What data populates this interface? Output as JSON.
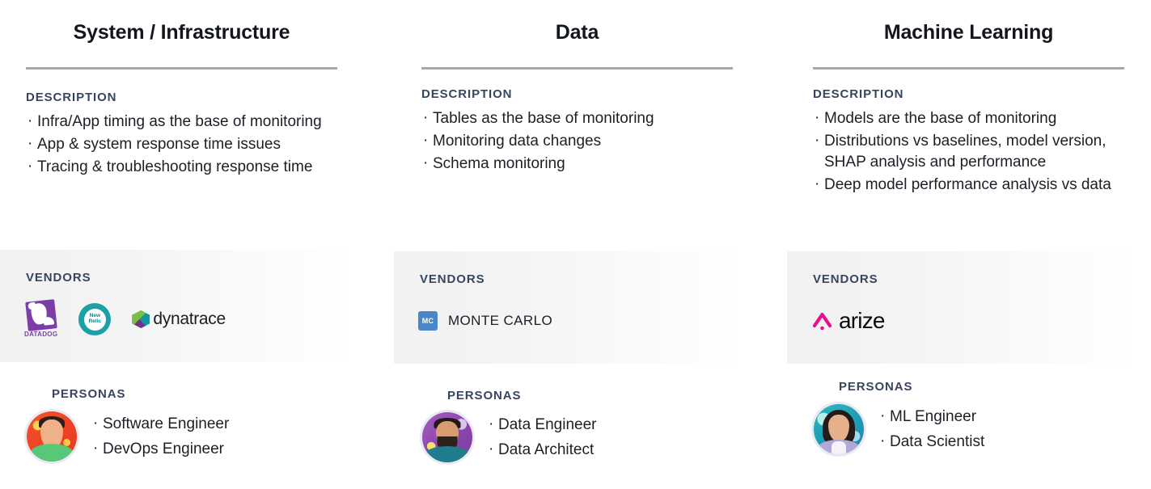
{
  "columns": [
    {
      "title": "System / Infrastructure",
      "description_label": "DESCRIPTION",
      "description_items": [
        "Infra/App timing as the base of monitoring",
        "App & system response time issues",
        "Tracing & troubleshooting response time"
      ],
      "vendors_label": "VENDORS",
      "vendors": [
        {
          "name": "DATADOG",
          "icon": "datadog-logo"
        },
        {
          "name": "New Relic",
          "icon": "new-relic-logo",
          "line1": "New",
          "line2": "Relic"
        },
        {
          "name": "dynatrace",
          "icon": "dynatrace-logo"
        }
      ],
      "personas_label": "PERSONAS",
      "persona_avatar": "persona-avatar-software-engineer",
      "personas": [
        "Software Engineer",
        "DevOps Engineer"
      ]
    },
    {
      "title": "Data",
      "description_label": "DESCRIPTION",
      "description_items": [
        "Tables as the base of monitoring",
        "Monitoring data changes",
        "Schema monitoring"
      ],
      "vendors_label": "VENDORS",
      "vendors": [
        {
          "name": "MONTE CARLO",
          "icon": "monte-carlo-logo",
          "monogram": "MC"
        }
      ],
      "personas_label": "PERSONAS",
      "persona_avatar": "persona-avatar-data-engineer",
      "personas": [
        "Data Engineer",
        "Data Architect"
      ]
    },
    {
      "title": "Machine Learning",
      "description_label": "DESCRIPTION",
      "description_items": [
        "Models are the base of monitoring",
        "Distributions vs baselines, model version, SHAP analysis and performance",
        "Deep model performance analysis vs data"
      ],
      "vendors_label": "VENDORS",
      "vendors": [
        {
          "name": "arize",
          "icon": "arize-logo"
        }
      ],
      "personas_label": "PERSONAS",
      "persona_avatar": "persona-avatar-ml-engineer",
      "personas": [
        "ML Engineer",
        "Data Scientist"
      ]
    }
  ],
  "colors": {
    "title": "#13161c",
    "section_label": "#37465e",
    "body_text": "#1c1f26",
    "rule": "#a7a9ac",
    "band_start": "#f1f1f2",
    "datadog_purple": "#7b3ea8",
    "new_relic_teal": "#1ba0a6",
    "dynatrace_green": "#7ac143",
    "monte_carlo_blue": "#4a86c8",
    "arize_pink": "#ec0d8c"
  }
}
